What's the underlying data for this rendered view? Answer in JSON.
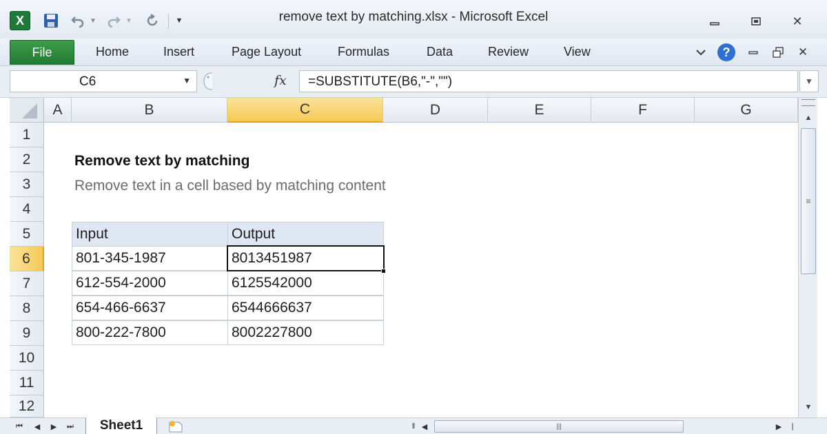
{
  "window": {
    "title": "remove text by matching.xlsx  -  Microsoft Excel",
    "app_icon": "X",
    "controls": {
      "minimize": "▭",
      "restore": "▣",
      "close": "✕"
    }
  },
  "ribbon": {
    "file_label": "File",
    "tabs": [
      "Home",
      "Insert",
      "Page Layout",
      "Formulas",
      "Data",
      "Review",
      "View"
    ],
    "help_icon": "?"
  },
  "formula_bar": {
    "name_box": "C6",
    "fx_label": "fx",
    "formula": "=SUBSTITUTE(B6,\"-\",\"\")"
  },
  "grid": {
    "columns": [
      "A",
      "B",
      "C",
      "D",
      "E",
      "F",
      "G"
    ],
    "rows": [
      "1",
      "2",
      "3",
      "4",
      "5",
      "6",
      "7",
      "8",
      "9",
      "10",
      "11",
      "12"
    ],
    "selected_column": "C",
    "selected_row": "6",
    "title": "Remove text by matching",
    "subtitle": "Remove text in a cell based by matching content",
    "table": {
      "headers": [
        "Input",
        "Output"
      ],
      "rows": [
        [
          "801-345-1987",
          "8013451987"
        ],
        [
          "612-554-2000",
          "6125542000"
        ],
        [
          "654-466-6637",
          "6544666637"
        ],
        [
          "800-222-7800",
          "8002227800"
        ]
      ]
    }
  },
  "sheets": {
    "active": "Sheet1"
  },
  "colors": {
    "file_tab": "#217a31",
    "selection_header": "#f6c955",
    "table_header": "#dfe8f2"
  }
}
